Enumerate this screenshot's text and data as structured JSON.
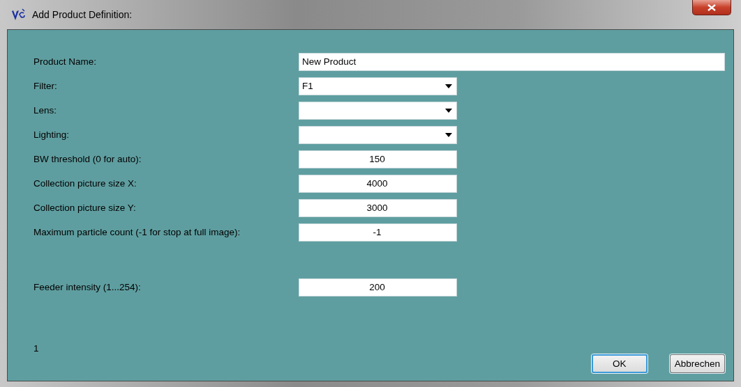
{
  "window": {
    "title": "Add Product Definition:"
  },
  "fields": [
    {
      "label": "Product Name:",
      "kind": "text",
      "value": "New Product"
    },
    {
      "label": "Filter:",
      "kind": "dropdown",
      "value": "F1"
    },
    {
      "label": "Lens:",
      "kind": "dropdown"
    },
    {
      "label": "Lighting:",
      "kind": "dropdown"
    },
    {
      "label": "BW threshold (0 for auto):",
      "kind": "number",
      "value": "150"
    },
    {
      "label": "Collection picture size X:",
      "kind": "number",
      "value": "4000"
    },
    {
      "label": "Collection picture size Y:",
      "kind": "number",
      "value": "3000"
    },
    {
      "label": "Maximum particle count (-1 for stop at full image):",
      "kind": "number",
      "value": "-1"
    }
  ],
  "feeder": {
    "label": "Feeder intensity (1...254):",
    "kind": "number",
    "value": "200"
  },
  "status_text": "1",
  "buttons": [
    {
      "label": "OK",
      "selected": true
    },
    {
      "label": "Abbrechen",
      "selected": false
    }
  ]
}
